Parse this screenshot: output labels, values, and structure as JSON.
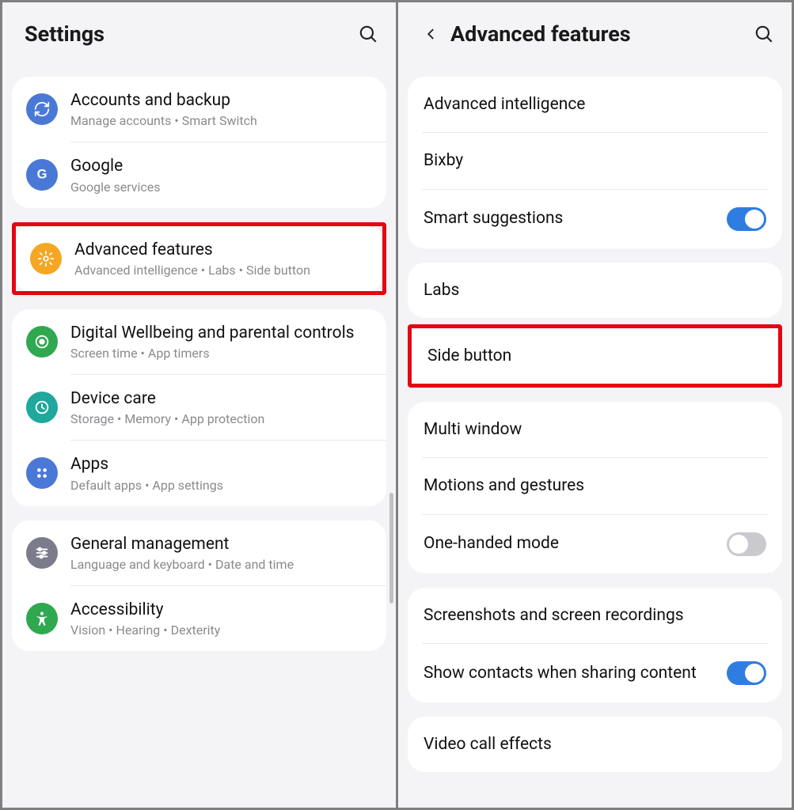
{
  "left": {
    "title": "Settings",
    "groups": [
      {
        "items": [
          {
            "icon": "sync",
            "color": "#4a78d6",
            "rounded": true,
            "title": "Accounts and backup",
            "sub": "Manage accounts  •  Smart Switch"
          },
          {
            "icon": "google",
            "color": "#4a78d6",
            "rounded": true,
            "title": "Google",
            "sub": "Google services"
          }
        ]
      },
      {
        "highlight": true,
        "items": [
          {
            "icon": "gear",
            "color": "#f5a623",
            "rounded": true,
            "title": "Advanced features",
            "sub": "Advanced intelligence  •  Labs  •  Side button"
          }
        ]
      },
      {
        "items": [
          {
            "icon": "target",
            "color": "#2fa84f",
            "rounded": true,
            "title": "Digital Wellbeing and parental controls",
            "sub": "Screen time  •  App timers"
          },
          {
            "icon": "care",
            "color": "#1fa89b",
            "rounded": true,
            "title": "Device care",
            "sub": "Storage  •  Memory  •  App protection"
          },
          {
            "icon": "apps",
            "color": "#4a78d6",
            "rounded": true,
            "title": "Apps",
            "sub": "Default apps  •  App settings"
          }
        ]
      },
      {
        "items": [
          {
            "icon": "sliders",
            "color": "#7b7b8c",
            "rounded": true,
            "title": "General management",
            "sub": "Language and keyboard  •  Date and time"
          },
          {
            "icon": "accessibility",
            "color": "#2fa84f",
            "rounded": true,
            "title": "Accessibility",
            "sub": "Vision  •  Hearing  •  Dexterity"
          }
        ]
      }
    ]
  },
  "right": {
    "title": "Advanced features",
    "groups": [
      {
        "items": [
          {
            "title": "Advanced intelligence"
          },
          {
            "title": "Bixby"
          },
          {
            "title": "Smart suggestions",
            "toggle": true,
            "on": true
          }
        ]
      },
      {
        "items": [
          {
            "title": "Labs"
          }
        ]
      },
      {
        "highlight": true,
        "items": [
          {
            "title": "Side button"
          }
        ]
      },
      {
        "items": [
          {
            "title": "Multi window"
          },
          {
            "title": "Motions and gestures"
          },
          {
            "title": "One-handed mode",
            "toggle": true,
            "on": false
          }
        ]
      },
      {
        "items": [
          {
            "title": "Screenshots and screen recordings"
          },
          {
            "title": "Show contacts when sharing content",
            "toggle": true,
            "on": true
          }
        ]
      },
      {
        "items": [
          {
            "title": "Video call effects"
          }
        ]
      }
    ]
  }
}
